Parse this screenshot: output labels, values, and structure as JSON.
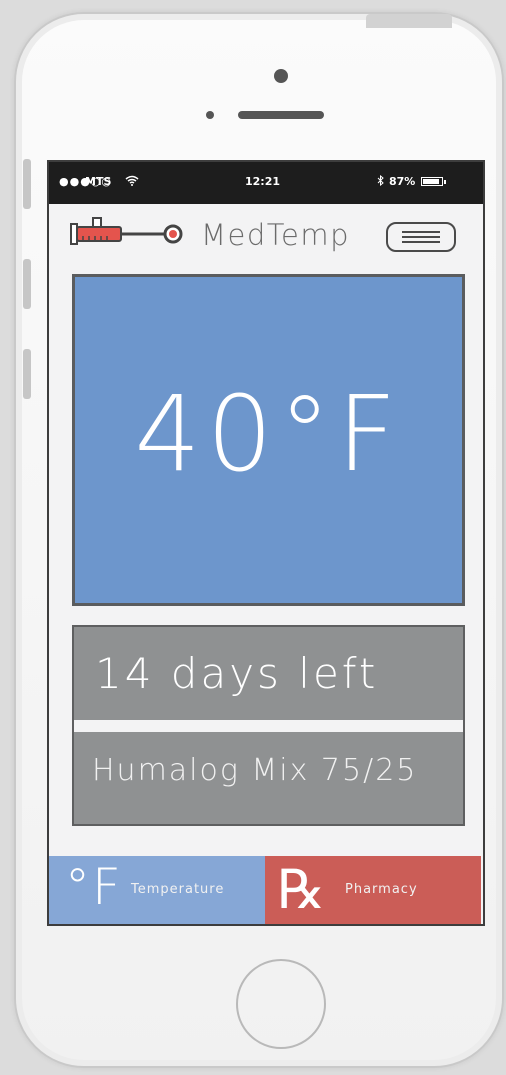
{
  "status_bar": {
    "signal": "●●●○○",
    "carrier": "MTS",
    "wifi_icon": "wifi-icon",
    "time": "12:21",
    "bluetooth_icon": "bluetooth-icon",
    "battery": "87%"
  },
  "app": {
    "title": "MedTemp",
    "logo_icon": "thermometer-syringe-icon",
    "menu_icon": "hamburger-icon"
  },
  "temperature": {
    "value": "40°F",
    "panel_color": "#6d96cc"
  },
  "medication": {
    "days_left": "14 days left",
    "name": "Humalog Mix 75/25"
  },
  "tabs": [
    {
      "icon": "°F",
      "label": "Temperature",
      "color": "#86a7d6"
    },
    {
      "icon": "℞",
      "label": "Pharmacy",
      "color": "#cb5d57"
    }
  ]
}
